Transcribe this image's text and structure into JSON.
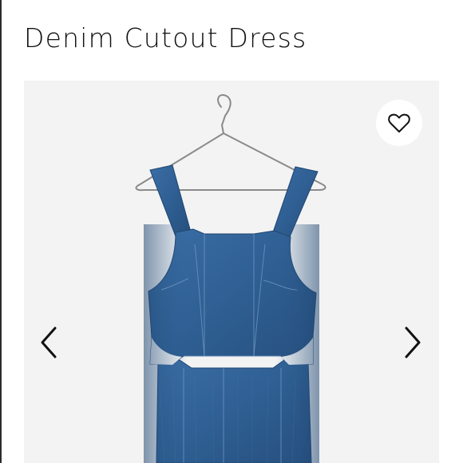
{
  "product": {
    "title": "Denim Cutout Dress"
  },
  "gallery": {
    "image_icon": "denim-dress-photo",
    "favorite_icon": "heart-outline-icon",
    "prev_icon": "chevron-left-icon",
    "next_icon": "chevron-right-icon"
  },
  "colors": {
    "background": "#ffffff",
    "gallery_bg": "#f3f3f3",
    "denim": "#2f5f93",
    "denim_dark": "#244c7a",
    "text": "#111111"
  }
}
